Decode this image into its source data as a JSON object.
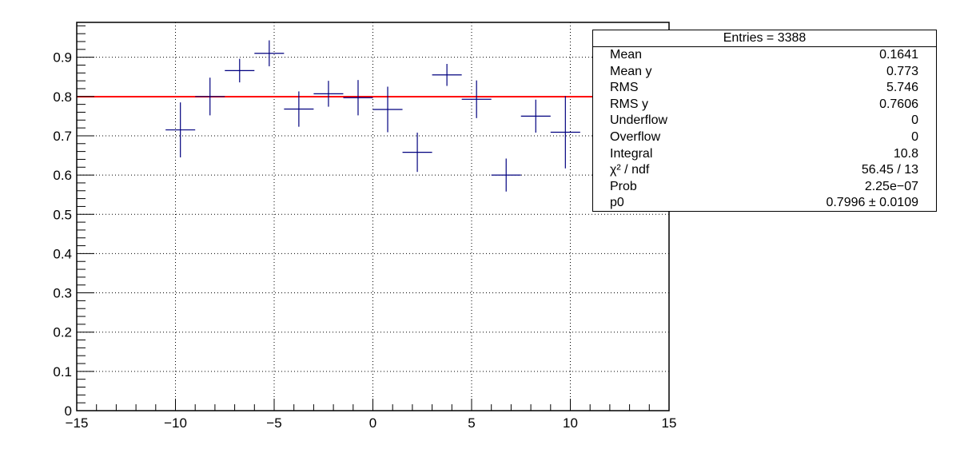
{
  "chart_data": {
    "type": "scatter",
    "title": "",
    "xlabel": "",
    "ylabel": "",
    "xlim": [
      -15,
      15
    ],
    "ylim": [
      0,
      1
    ],
    "x_ticks": [
      -15,
      -10,
      -5,
      0,
      5,
      10,
      15
    ],
    "x_tick_labels": [
      "−15",
      "−10",
      "−5",
      "0",
      "5",
      "10",
      "15"
    ],
    "y_ticks": [
      0,
      0.1,
      0.2,
      0.3,
      0.4,
      0.5,
      0.6,
      0.7,
      0.8,
      0.9
    ],
    "y_tick_labels": [
      "0",
      "0.1",
      "0.2",
      "0.3",
      "0.4",
      "0.5",
      "0.6",
      "0.7",
      "0.8",
      "0.9"
    ],
    "grid": true,
    "bin_half_width": 0.75,
    "series": [
      {
        "color": "#00007f",
        "points": [
          {
            "x": -9.75,
            "y": 0.715,
            "err": 0.07
          },
          {
            "x": -8.25,
            "y": 0.8,
            "err": 0.048
          },
          {
            "x": -6.75,
            "y": 0.866,
            "err": 0.03
          },
          {
            "x": -5.25,
            "y": 0.91,
            "err": 0.033
          },
          {
            "x": -3.75,
            "y": 0.768,
            "err": 0.045
          },
          {
            "x": -2.25,
            "y": 0.807,
            "err": 0.033
          },
          {
            "x": -0.75,
            "y": 0.797,
            "err": 0.045
          },
          {
            "x": 0.75,
            "y": 0.767,
            "err": 0.058
          },
          {
            "x": 2.25,
            "y": 0.658,
            "err": 0.05
          },
          {
            "x": 3.75,
            "y": 0.855,
            "err": 0.028
          },
          {
            "x": 5.25,
            "y": 0.793,
            "err": 0.048
          },
          {
            "x": 6.75,
            "y": 0.6,
            "err": 0.042
          },
          {
            "x": 8.25,
            "y": 0.75,
            "err": 0.042
          },
          {
            "x": 9.75,
            "y": 0.709,
            "err": 0.092
          }
        ]
      }
    ],
    "fit_line": {
      "y": 0.7996,
      "x_range": [
        -15,
        12.5
      ],
      "color": "#ff0000"
    }
  },
  "stats": {
    "title": "Entries = 3388",
    "rows": [
      {
        "name": "Mean",
        "value": "0.1641"
      },
      {
        "name": "Mean y",
        "value": "0.773"
      },
      {
        "name": "RMS",
        "value": "5.746"
      },
      {
        "name": "RMS y",
        "value": "0.7606"
      },
      {
        "name": "Underflow",
        "value": "0"
      },
      {
        "name": "Overflow",
        "value": "0"
      },
      {
        "name": "Integral",
        "value": "10.8"
      },
      {
        "name": "χ² / ndf",
        "value": "56.45 / 13"
      },
      {
        "name": "Prob",
        "value": "2.25e−07"
      },
      {
        "name": "p0",
        "value": "0.7996 ± 0.0109"
      }
    ]
  }
}
